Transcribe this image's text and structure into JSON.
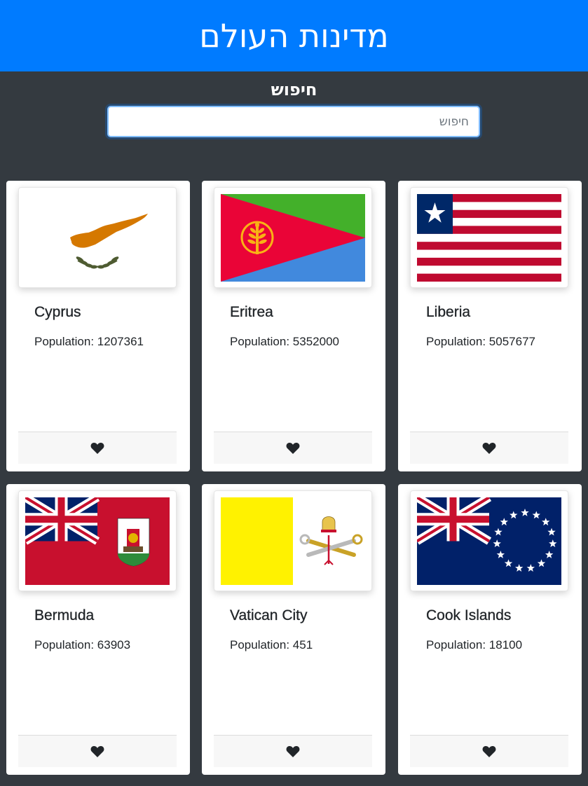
{
  "header": {
    "title": "מדינות העולם"
  },
  "search": {
    "label": "חיפוש",
    "placeholder": "חיפוש",
    "value": ""
  },
  "pop_prefix": "Population: ",
  "countries": [
    {
      "name": "Cyprus",
      "population": "1207361",
      "flag_icon": "cyprus-flag-icon"
    },
    {
      "name": "Eritrea",
      "population": "5352000",
      "flag_icon": "eritrea-flag-icon"
    },
    {
      "name": "Liberia",
      "population": "5057677",
      "flag_icon": "liberia-flag-icon"
    },
    {
      "name": "Bermuda",
      "population": "63903",
      "flag_icon": "bermuda-flag-icon"
    },
    {
      "name": "Vatican City",
      "population": "451",
      "flag_icon": "vatican-flag-icon"
    },
    {
      "name": "Cook Islands",
      "population": "18100",
      "flag_icon": "cook-islands-flag-icon"
    }
  ],
  "colors": {
    "header_bg": "#007bff",
    "page_bg": "#343a40",
    "card_bg": "#ffffff",
    "footer_bg": "#f7f7f7"
  }
}
